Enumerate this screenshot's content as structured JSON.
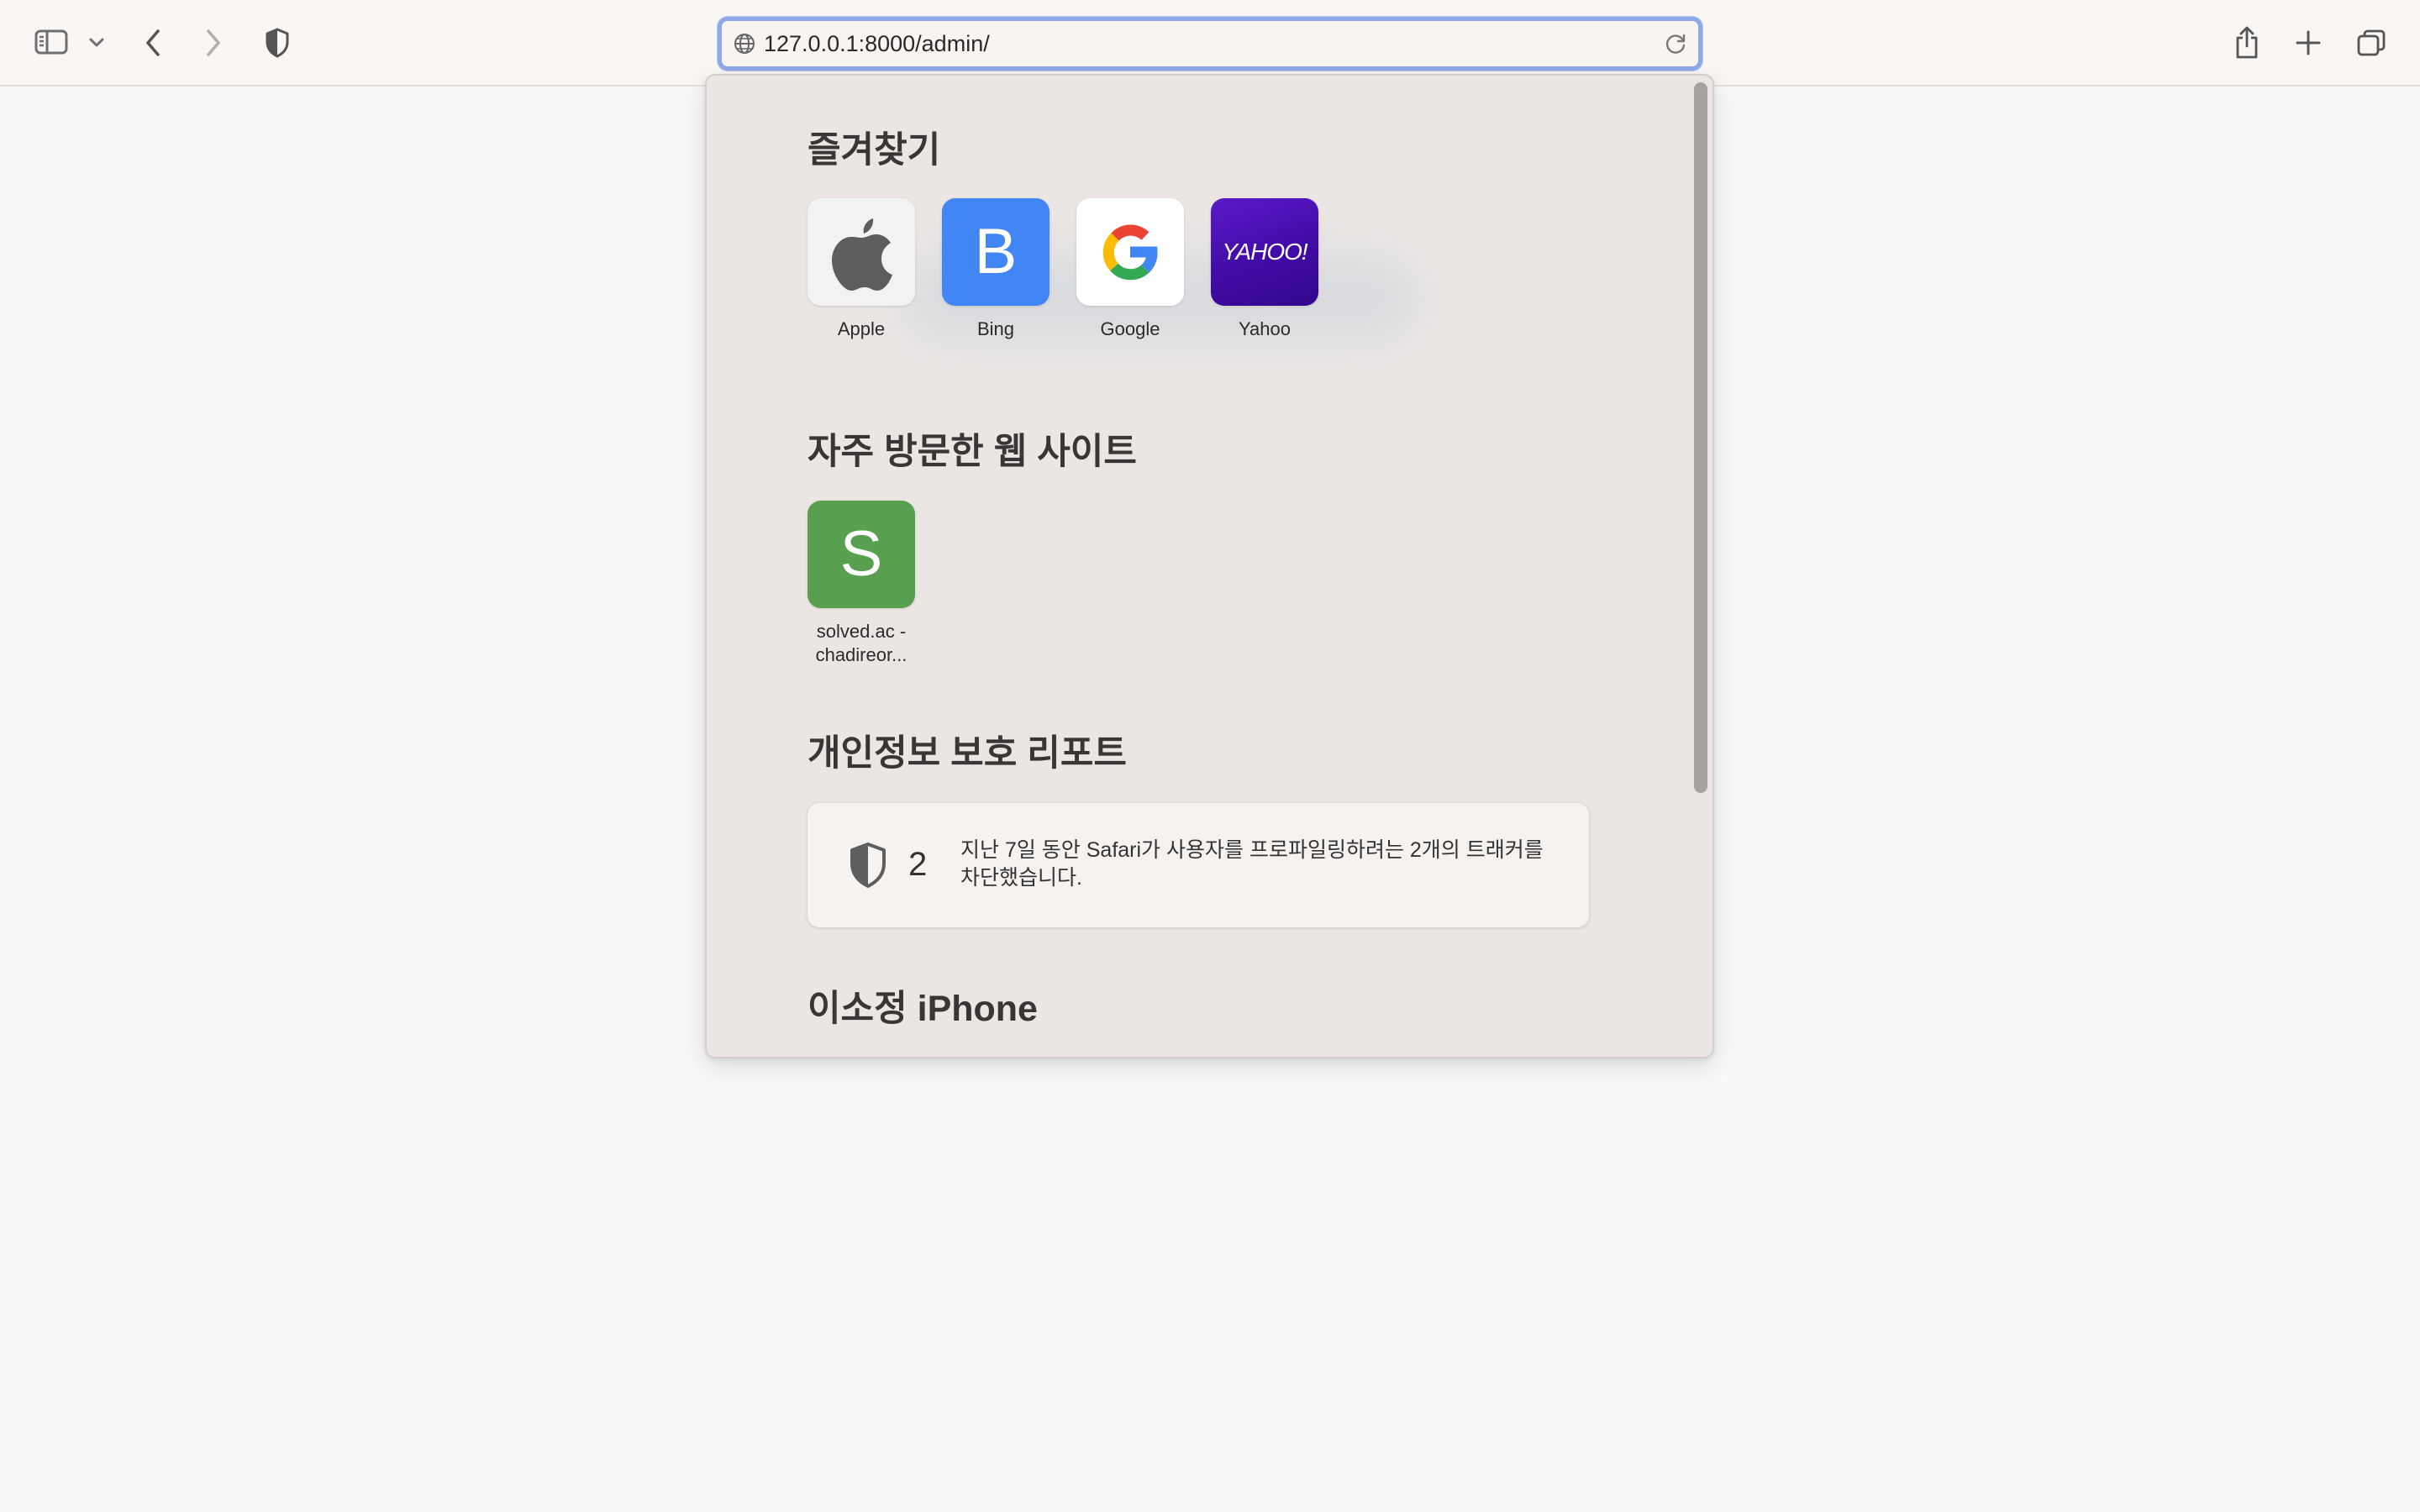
{
  "toolbar": {
    "sidebar_icon": "sidebar-icon",
    "sidebar_menu_icon": "chevron-down-icon",
    "back_icon": "chevron-left-icon",
    "forward_icon": "chevron-right-icon",
    "privacy_icon": "shield-icon",
    "share_icon": "share-icon",
    "new_tab_icon": "plus-icon",
    "tab_overview_icon": "tabs-icon"
  },
  "address_bar": {
    "url": "127.0.0.1:8000/admin/",
    "globe_icon": "globe-icon",
    "reload_icon": "reload-icon",
    "accent_color": "#8fa8e8"
  },
  "start_page": {
    "favorites": {
      "title": "즐겨찾기",
      "items": [
        {
          "label": "Apple",
          "icon": "apple-icon",
          "bg": "#f2f2f2"
        },
        {
          "label": "Bing",
          "icon": "letter-b",
          "letter": "B",
          "bg": "#4285f4"
        },
        {
          "label": "Google",
          "icon": "google-icon",
          "bg": "#ffffff"
        },
        {
          "label": "Yahoo",
          "icon": "yahoo-logo",
          "logo_text": "YAHOO!",
          "bg": "#4b0fb6"
        }
      ]
    },
    "frequently_visited": {
      "title": "자주 방문한 웹 사이트",
      "items": [
        {
          "label_line1": "solved.ac -",
          "label_line2": "chadireor...",
          "letter": "S",
          "bg": "#58a04f"
        }
      ]
    },
    "privacy_report": {
      "title": "개인정보 보호 리포트",
      "count": "2",
      "text": "지난 7일 동안 Safari가 사용자를 프로파일링하려는 2개의 트래커를 차단했습니다."
    },
    "icloud_tabs": {
      "title": "이소정 iPhone"
    }
  }
}
